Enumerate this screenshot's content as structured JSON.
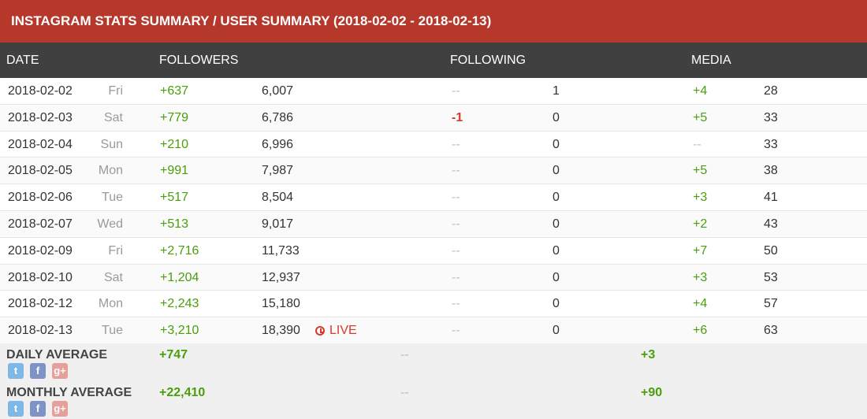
{
  "title": "INSTAGRAM STATS SUMMARY / USER SUMMARY (2018-02-02 - 2018-02-13)",
  "headers": {
    "date": "DATE",
    "followers": "FOLLOWERS",
    "following": "FOLLOWING",
    "media": "MEDIA"
  },
  "live_label": "LIVE",
  "rows": [
    {
      "date": "2018-02-02",
      "day": "Fri",
      "followers_change": "+637",
      "followers_total": "6,007",
      "following_change": "--",
      "following_total": "1",
      "media_change": "+4",
      "media_total": "28"
    },
    {
      "date": "2018-02-03",
      "day": "Sat",
      "followers_change": "+779",
      "followers_total": "6,786",
      "following_change": "-1",
      "following_total": "0",
      "media_change": "+5",
      "media_total": "33"
    },
    {
      "date": "2018-02-04",
      "day": "Sun",
      "followers_change": "+210",
      "followers_total": "6,996",
      "following_change": "--",
      "following_total": "0",
      "media_change": "--",
      "media_total": "33"
    },
    {
      "date": "2018-02-05",
      "day": "Mon",
      "followers_change": "+991",
      "followers_total": "7,987",
      "following_change": "--",
      "following_total": "0",
      "media_change": "+5",
      "media_total": "38"
    },
    {
      "date": "2018-02-06",
      "day": "Tue",
      "followers_change": "+517",
      "followers_total": "8,504",
      "following_change": "--",
      "following_total": "0",
      "media_change": "+3",
      "media_total": "41"
    },
    {
      "date": "2018-02-07",
      "day": "Wed",
      "followers_change": "+513",
      "followers_total": "9,017",
      "following_change": "--",
      "following_total": "0",
      "media_change": "+2",
      "media_total": "43"
    },
    {
      "date": "2018-02-09",
      "day": "Fri",
      "followers_change": "+2,716",
      "followers_total": "11,733",
      "following_change": "--",
      "following_total": "0",
      "media_change": "+7",
      "media_total": "50"
    },
    {
      "date": "2018-02-10",
      "day": "Sat",
      "followers_change": "+1,204",
      "followers_total": "12,937",
      "following_change": "--",
      "following_total": "0",
      "media_change": "+3",
      "media_total": "53"
    },
    {
      "date": "2018-02-12",
      "day": "Mon",
      "followers_change": "+2,243",
      "followers_total": "15,180",
      "following_change": "--",
      "following_total": "0",
      "media_change": "+4",
      "media_total": "57"
    },
    {
      "date": "2018-02-13",
      "day": "Tue",
      "followers_change": "+3,210",
      "followers_total": "18,390",
      "following_change": "--",
      "following_total": "0",
      "media_change": "+6",
      "media_total": "63",
      "live": true
    }
  ],
  "daily_average": {
    "label": "DAILY AVERAGE",
    "followers": "+747",
    "following": "--",
    "media": "+3"
  },
  "monthly_average": {
    "label": "MONTHLY AVERAGE",
    "followers": "+22,410",
    "following": "--",
    "media": "+90"
  },
  "share_icons": [
    "twitter-icon",
    "facebook-icon",
    "google-plus-icon"
  ],
  "share_glyphs": {
    "twitter": "t",
    "facebook": "f",
    "google_plus": "g+"
  },
  "colors": {
    "title_bar": "#b5382b",
    "header_bar": "#404040",
    "positive": "#4a9e0b",
    "negative": "#d63a2b"
  }
}
